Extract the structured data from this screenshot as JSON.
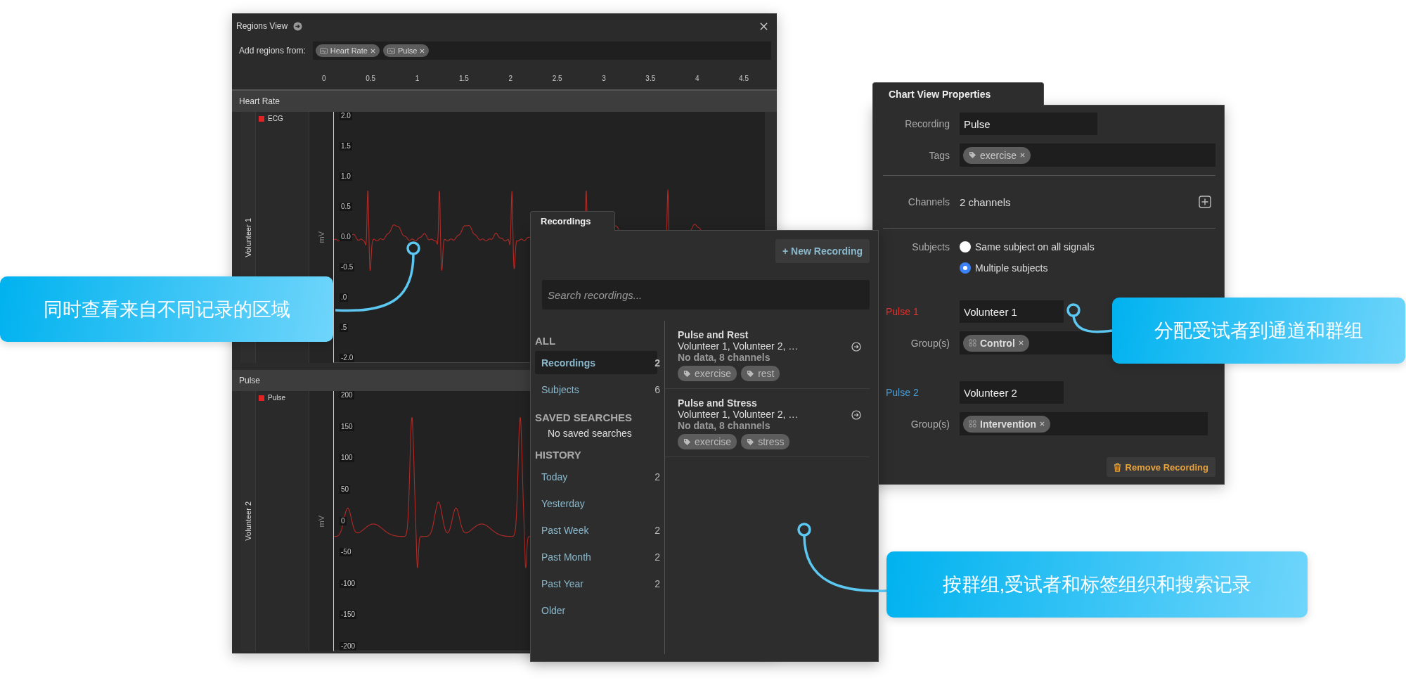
{
  "regions_view": {
    "title": "Regions View",
    "add_label": "Add regions from:",
    "sources": [
      {
        "label": "Heart Rate"
      },
      {
        "label": "Pulse"
      }
    ],
    "x_ticks": [
      "0",
      "0.5",
      "1",
      "1.5",
      "2",
      "2.5",
      "3",
      "3.5",
      "4",
      "4.5"
    ],
    "tracks": [
      {
        "title": "Heart Rate",
        "subject": "Volunteer 1",
        "legend": "ECG",
        "unit": "mV",
        "kind": "ecg",
        "y_ticks": [
          "2.0",
          "1.5",
          "1.0",
          "0.5",
          "0.0",
          "-0.5",
          ".0",
          ".5",
          "-2.0"
        ]
      },
      {
        "title": "Pulse",
        "subject": "Volunteer 2",
        "legend": "Pulse",
        "unit": "mV",
        "kind": "pulse",
        "y_ticks": [
          "200",
          "150",
          "100",
          "50",
          "0",
          "-50",
          "-100",
          "-150",
          "-200"
        ]
      }
    ]
  },
  "recordings": {
    "tab": "Recordings",
    "new_button": "+ New Recording",
    "search": {
      "placeholder": "Search recordings..."
    },
    "sections": [
      {
        "heading": "ALL",
        "items": [
          {
            "label": "Recordings",
            "count": "2",
            "selected": true
          },
          {
            "label": "Subjects",
            "count": "6",
            "selected": false
          }
        ]
      },
      {
        "heading": "SAVED SEARCHES",
        "empty": "No saved searches"
      },
      {
        "heading": "HISTORY",
        "items": [
          {
            "label": "Today",
            "count": "2",
            "selected": false
          },
          {
            "label": "Yesterday",
            "selected": false
          },
          {
            "label": "Past Week",
            "count": "2",
            "selected": false
          },
          {
            "label": "Past Month",
            "count": "2",
            "selected": false
          },
          {
            "label": "Past Year",
            "count": "2",
            "selected": false
          },
          {
            "label": "Older",
            "selected": false
          }
        ]
      }
    ],
    "list": [
      {
        "title": "Pulse and Rest",
        "subjects": "Volunteer 1, Volunteer 2, …",
        "info": "No data, 8 channels",
        "tags": [
          "exercise",
          "rest"
        ]
      },
      {
        "title": "Pulse and Stress",
        "subjects": "Volunteer 1, Volunteer 2, …",
        "info": "No data, 8 channels",
        "tags": [
          "exercise",
          "stress"
        ]
      }
    ]
  },
  "properties": {
    "tab": "Chart View Properties",
    "recording": {
      "label": "Recording",
      "value": "Pulse"
    },
    "tags": {
      "label": "Tags",
      "items": [
        "exercise"
      ]
    },
    "channels": {
      "label": "Channels",
      "value": "2 channels"
    },
    "subjects": {
      "label": "Subjects",
      "options": [
        {
          "label": "Same subject on all signals",
          "selected": false
        },
        {
          "label": "Multiple subjects",
          "selected": true
        }
      ]
    },
    "signals": [
      {
        "name": "Pulse 1",
        "color": "#e8302a",
        "subject": "Volunteer 1",
        "groups_label": "Group(s)",
        "groups": [
          "Control"
        ]
      },
      {
        "name": "Pulse 2",
        "color": "#4a9fd8",
        "subject": "Volunteer 2",
        "groups_label": "Group(s)",
        "groups": [
          "Intervention"
        ]
      }
    ],
    "remove_button": "Remove Recording"
  },
  "callouts": [
    {
      "text": "同时查看来自不同记录的区域"
    },
    {
      "text": "分配受试者到通道和群组"
    },
    {
      "text": "按群组,受试者和标签组织和搜索记录"
    }
  ]
}
